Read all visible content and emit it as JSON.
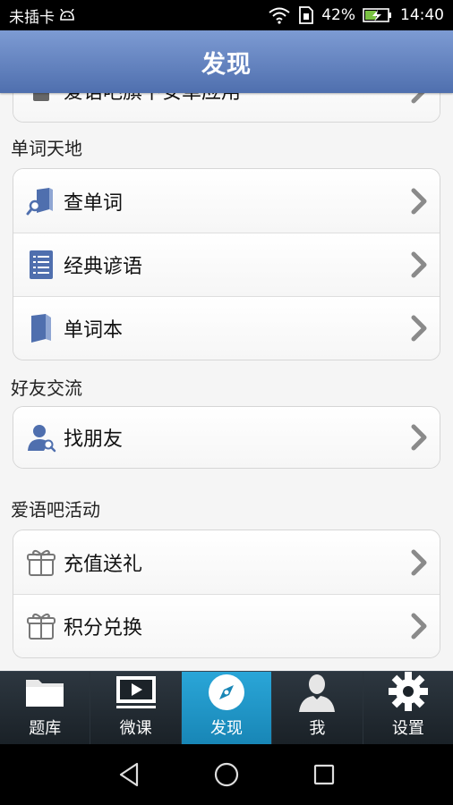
{
  "status": {
    "carrier": "未插卡",
    "battery": "42%",
    "time": "14:40"
  },
  "header": {
    "title": "发现"
  },
  "partial_row": {
    "label": "爱语吧旗下安卓应用"
  },
  "sections": [
    {
      "title": "单词天地",
      "items": [
        {
          "label": "查单词",
          "icon": "word-search-icon"
        },
        {
          "label": "经典谚语",
          "icon": "list-document-icon"
        },
        {
          "label": "单词本",
          "icon": "notebook-icon"
        }
      ]
    },
    {
      "title": "好友交流",
      "items": [
        {
          "label": "找朋友",
          "icon": "find-friend-icon"
        }
      ]
    },
    {
      "title": "爱语吧活动",
      "items": [
        {
          "label": "充值送礼",
          "icon": "gift-icon"
        },
        {
          "label": "积分兑换",
          "icon": "gift-icon"
        }
      ]
    }
  ],
  "tabs": [
    {
      "label": "题库",
      "icon": "folder-icon"
    },
    {
      "label": "微课",
      "icon": "video-play-icon"
    },
    {
      "label": "发现",
      "icon": "compass-icon",
      "active": true
    },
    {
      "label": "我",
      "icon": "person-icon"
    },
    {
      "label": "设置",
      "icon": "gear-icon"
    }
  ],
  "colors": {
    "header": "#5f7fbf",
    "active_tab": "#21a0d2",
    "icon": "#4f6fae"
  }
}
